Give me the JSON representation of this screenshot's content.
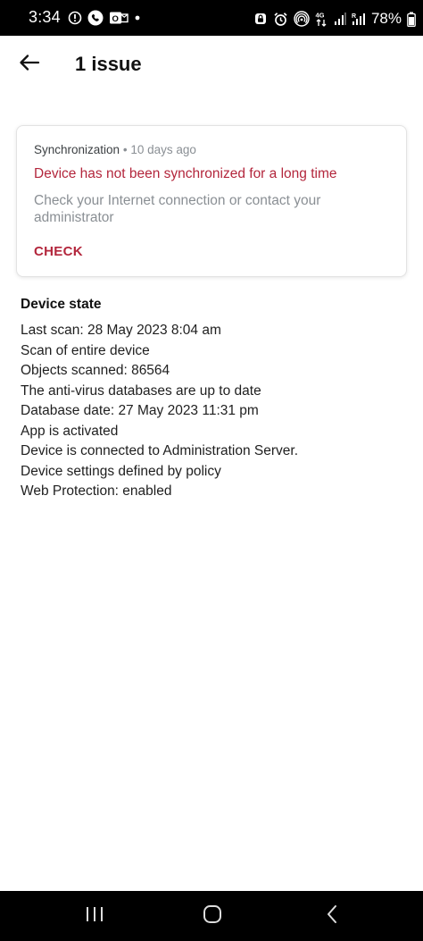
{
  "status_bar": {
    "time": "3:34",
    "left_icons": [
      "shield-alert-icon",
      "phone-call-icon",
      "outlook-icon",
      "dot-icon"
    ],
    "right_icons": [
      "lock-badge-icon",
      "alarm-icon",
      "hotspot-icon",
      "4g-data-icon",
      "signal-icon",
      "signal-roaming-icon"
    ],
    "battery": "78%"
  },
  "app_bar": {
    "title": "1 issue"
  },
  "issue_card": {
    "category": "Synchronization",
    "separator": "•",
    "time_ago": "10 days ago",
    "headline": "Device has not been synchronized for a long time",
    "description": "Check your Internet connection or contact your administrator",
    "action_label": "CHECK"
  },
  "device_state": {
    "title": "Device state",
    "lines": [
      "Last scan: 28 May 2023 8:04 am",
      "Scan of entire device",
      "Objects scanned: 86564",
      "The anti-virus databases are up to date",
      "Database date: 27 May 2023 11:31 pm",
      "App is activated",
      "Device is connected to Administration Server.",
      "Device settings defined by policy",
      "Web Protection: enabled"
    ]
  },
  "colors": {
    "accent_red": "#b3263c",
    "secondary_text": "#8a8f94",
    "system_bars": "#000000"
  }
}
